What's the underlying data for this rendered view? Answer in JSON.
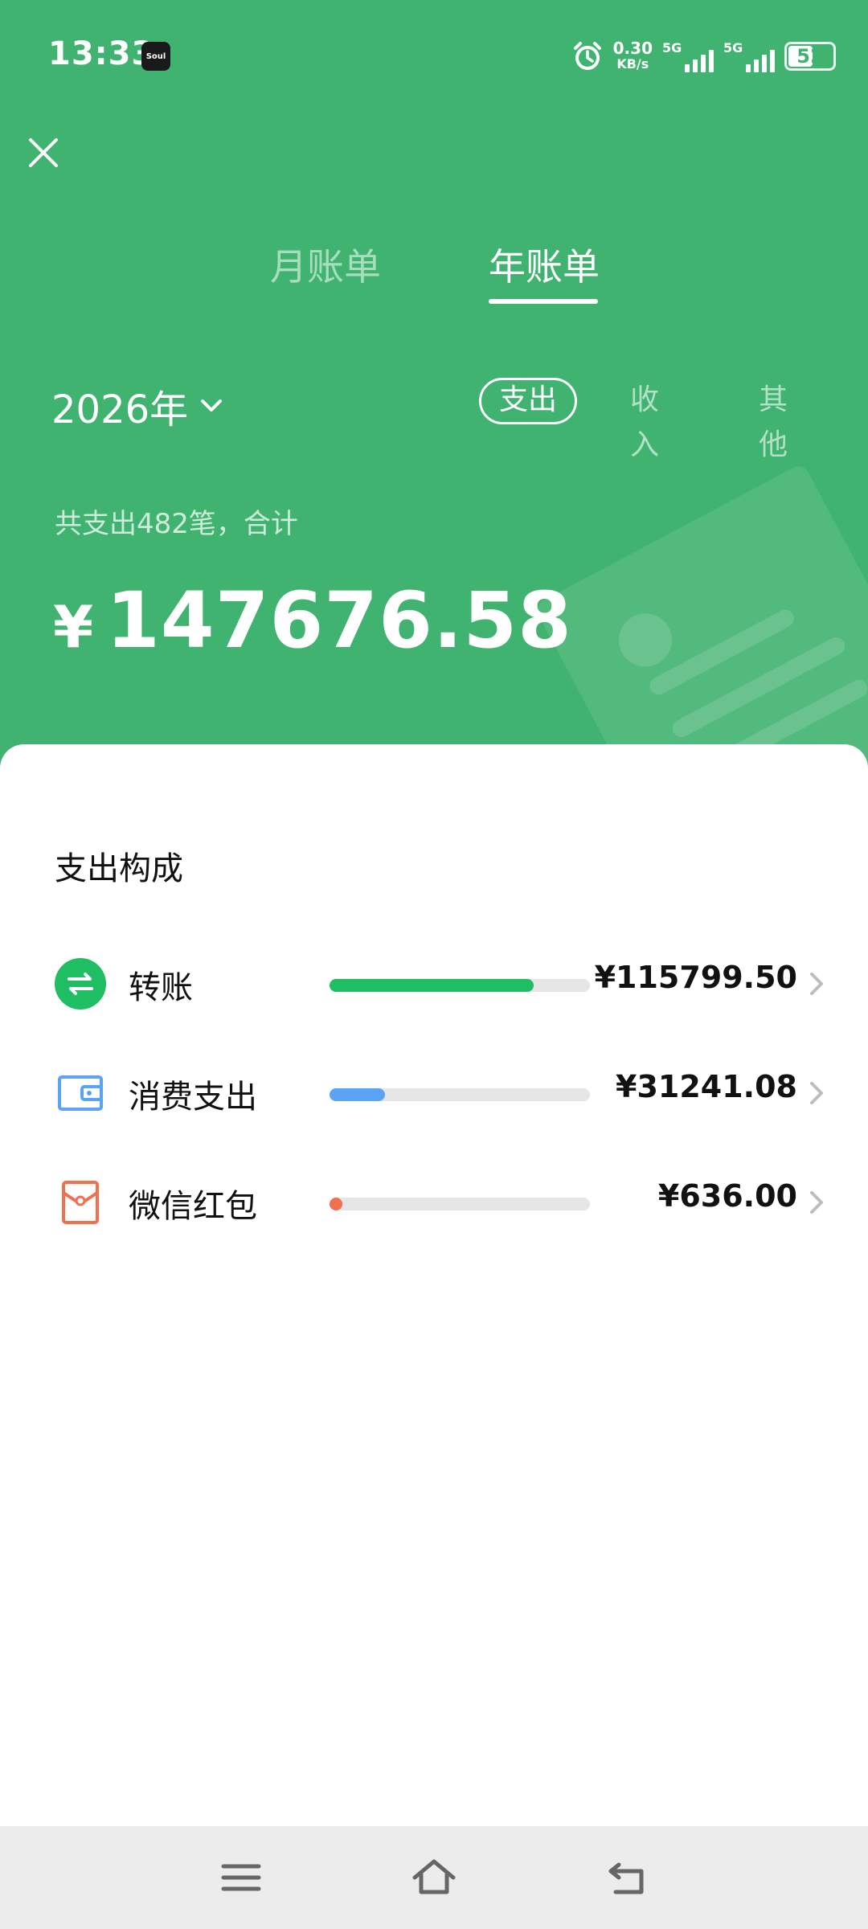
{
  "status_bar": {
    "time": "13:33",
    "app_badge": "Soul",
    "net_speed_value": "0.30",
    "net_speed_unit": "KB/s",
    "sim1": "5G",
    "sim2": "5G",
    "battery": "52"
  },
  "tabs": [
    {
      "label": "月账单",
      "active": false
    },
    {
      "label": "年账单",
      "active": true
    }
  ],
  "year_selector": {
    "label": "2026年"
  },
  "filters": [
    {
      "label": "支出",
      "active": true
    },
    {
      "label": "收入",
      "active": false
    },
    {
      "label": "其他",
      "active": false
    }
  ],
  "summary": {
    "text": "共支出482笔，合计",
    "currency": "¥",
    "total": "147676.58"
  },
  "composition": {
    "title": "支出构成",
    "items": [
      {
        "label": "转账",
        "amount": "¥115799.50",
        "fraction": 0.784,
        "color": "#1fbe63",
        "icon": "transfer-icon"
      },
      {
        "label": "消费支出",
        "amount": "¥31241.08",
        "fraction": 0.212,
        "color": "#5aa3f5",
        "icon": "wallet-icon"
      },
      {
        "label": "微信红包",
        "amount": "¥636.00",
        "fraction": 0.02,
        "color": "#f07050",
        "icon": "red-envelope-icon"
      }
    ]
  },
  "colors": {
    "header_green": "#3fb36f",
    "accent_green": "#1fbe63"
  }
}
